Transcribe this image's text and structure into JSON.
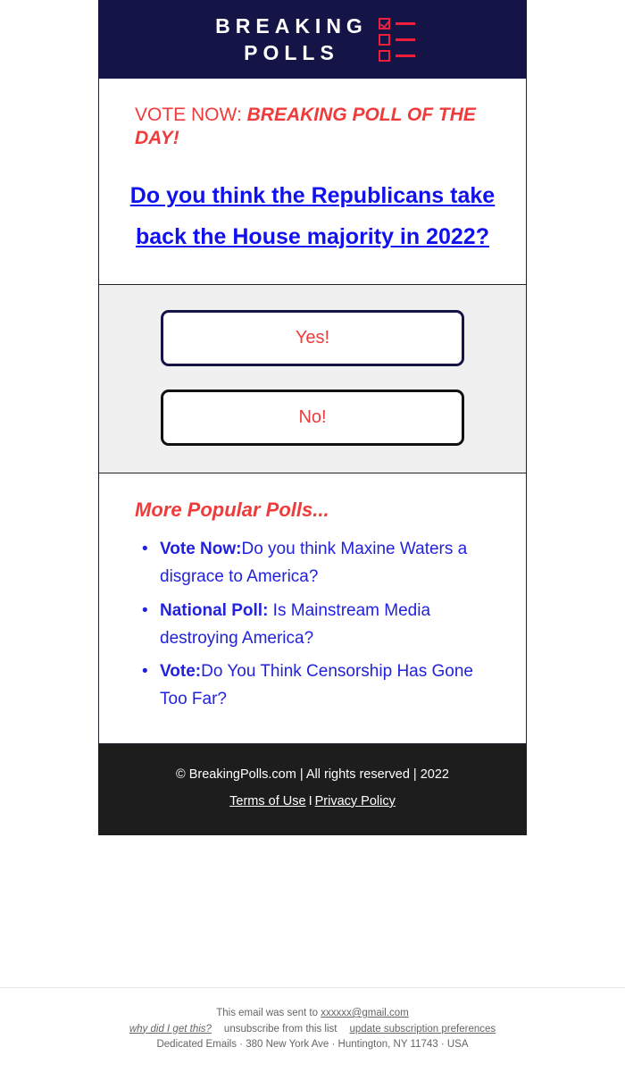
{
  "brand": {
    "line1": "BREAKING",
    "line2": "POLLS",
    "icon": "checklist-icon",
    "header_bg": "#141446",
    "accent_red": "#ef1e3c"
  },
  "headline": {
    "kicker_plain": "VOTE NOW: ",
    "kicker_emphasis": "BREAKING POLL OF THE DAY!",
    "question": "Do you think the Republicans take back the House majority in 2022?",
    "question_color": "#1111ee",
    "kicker_color": "#ee3b3b"
  },
  "vote": {
    "yes_label": "Yes!",
    "no_label": "No!",
    "text_color": "#ee3b3b",
    "yes_border": "#141446",
    "no_border": "#111111",
    "section_bg": "#f0f0f0"
  },
  "more_polls": {
    "title": "More Popular Polls...",
    "title_color": "#ee3b3b",
    "items": [
      {
        "label": "Vote Now:",
        "text": "Do you think Maxine Waters a disgrace to America?"
      },
      {
        "label": "National Poll:",
        "text": " Is Mainstream Media destroying America?"
      },
      {
        "label": "Vote:",
        "text": "Do You Think Censorship Has Gone Too Far?"
      }
    ]
  },
  "footer": {
    "copyright": "© BreakingPolls.com | All rights reserved | 2022",
    "terms_label": "Terms of Use",
    "separator": "I",
    "privacy_label": "Privacy Policy",
    "background": "#1d1d1d"
  },
  "mailer": {
    "sent_to_prefix": "This email was sent to ",
    "recipient_email": "xxxxxx@gmail.com",
    "why_link": "why did I get this?",
    "unsubscribe_link": "unsubscribe from this list",
    "preferences_link": "update subscription preferences",
    "address": "Dedicated Emails · 380 New York Ave · Huntington, NY 11743 · USA"
  }
}
